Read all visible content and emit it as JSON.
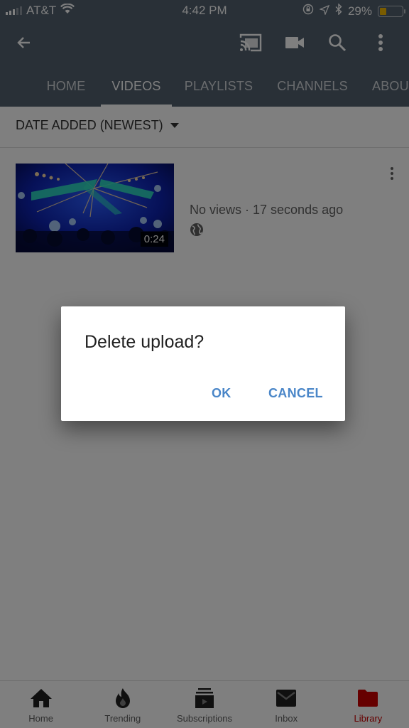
{
  "status_bar": {
    "carrier": "AT&T",
    "time": "4:42 PM",
    "battery_percent_label": "29%",
    "battery_level": 0.29,
    "battery_color": "#f5b800",
    "icons": [
      "signal-icon",
      "wifi-icon",
      "rotation-lock-icon",
      "location-icon",
      "bluetooth-icon",
      "battery-icon"
    ]
  },
  "app_bar": {
    "back_icon": "arrow-left-icon",
    "action_icons": [
      "cast-icon",
      "video-camera-icon",
      "search-icon",
      "more-vert-icon"
    ],
    "tabs": [
      {
        "label": "HOME",
        "active": false
      },
      {
        "label": "VIDEOS",
        "active": true
      },
      {
        "label": "PLAYLISTS",
        "active": false
      },
      {
        "label": "CHANNELS",
        "active": false
      },
      {
        "label": "ABOUT",
        "active": false
      }
    ]
  },
  "sort": {
    "label": "DATE ADDED (NEWEST)"
  },
  "videos": [
    {
      "duration": "0:24",
      "meta": "No views · 17 seconds ago",
      "visibility_icon": "globe-icon"
    }
  ],
  "dialog": {
    "title": "Delete upload?",
    "ok_label": "OK",
    "cancel_label": "CANCEL",
    "button_color": "#4a86c8"
  },
  "bottom_nav": {
    "items": [
      {
        "label": "Home",
        "icon": "home-icon",
        "active": false
      },
      {
        "label": "Trending",
        "icon": "flame-icon",
        "active": false
      },
      {
        "label": "Subscriptions",
        "icon": "subscriptions-icon",
        "active": false
      },
      {
        "label": "Inbox",
        "icon": "mail-icon",
        "active": false
      },
      {
        "label": "Library",
        "icon": "folder-icon",
        "active": true
      }
    ],
    "active_color": "#cc0000"
  }
}
